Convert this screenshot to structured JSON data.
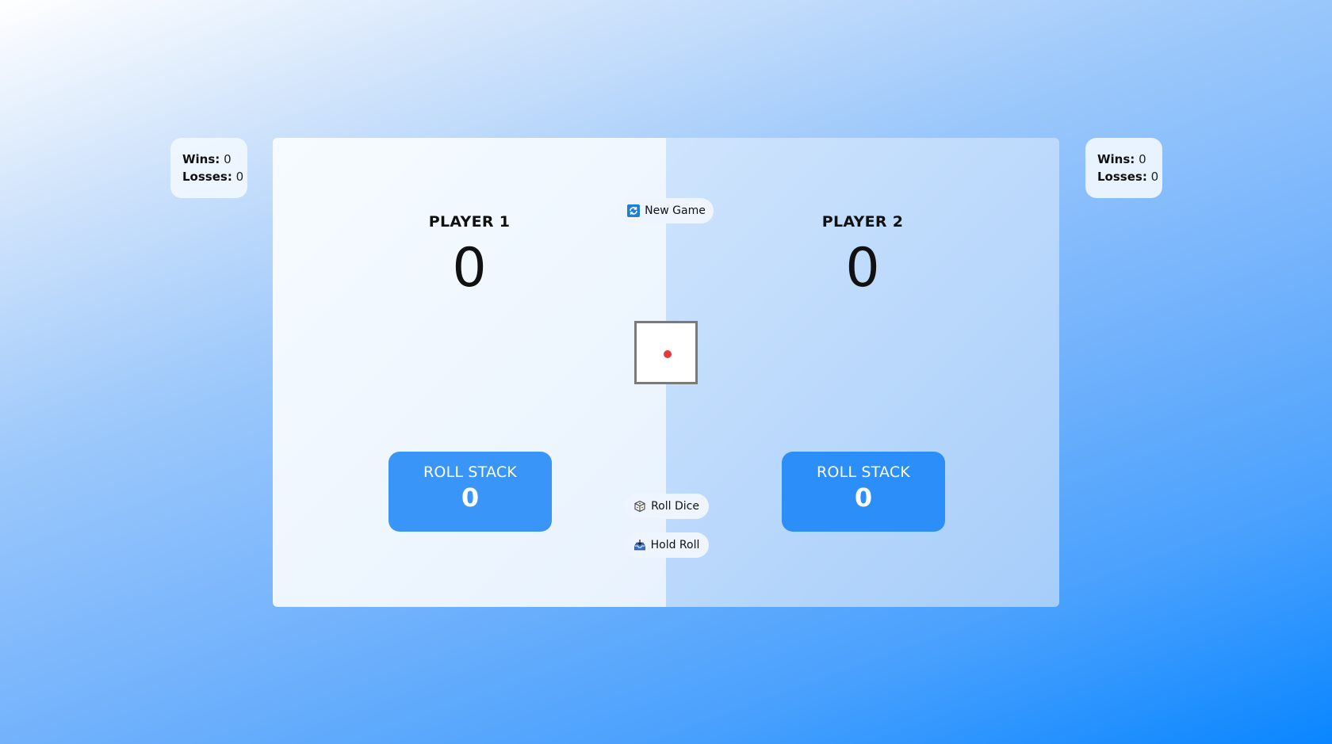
{
  "colors": {
    "roll_stack_p1": "#3a95f8",
    "roll_stack_p2": "#2b8ef9",
    "pip": "#e03c3c"
  },
  "left_stats": {
    "wins_label": "Wins:",
    "wins_value": "0",
    "losses_label": "Losses:",
    "losses_value": "0"
  },
  "right_stats": {
    "wins_label": "Wins:",
    "wins_value": "0",
    "losses_label": "Losses:",
    "losses_value": "0"
  },
  "player1": {
    "name": "PLAYER 1",
    "score": "0",
    "roll_stack_label": "ROLL STACK",
    "roll_stack_value": "0"
  },
  "player2": {
    "name": "PLAYER 2",
    "score": "0",
    "roll_stack_label": "ROLL STACK",
    "roll_stack_value": "0"
  },
  "controls": {
    "new_game_label": "New Game",
    "new_game_icon": "refresh-icon",
    "roll_dice_label": "Roll Dice",
    "roll_dice_icon": "dice-icon",
    "hold_roll_label": "Hold Roll",
    "hold_roll_icon": "inbox-tray-icon"
  },
  "die": {
    "face_value": 1
  }
}
